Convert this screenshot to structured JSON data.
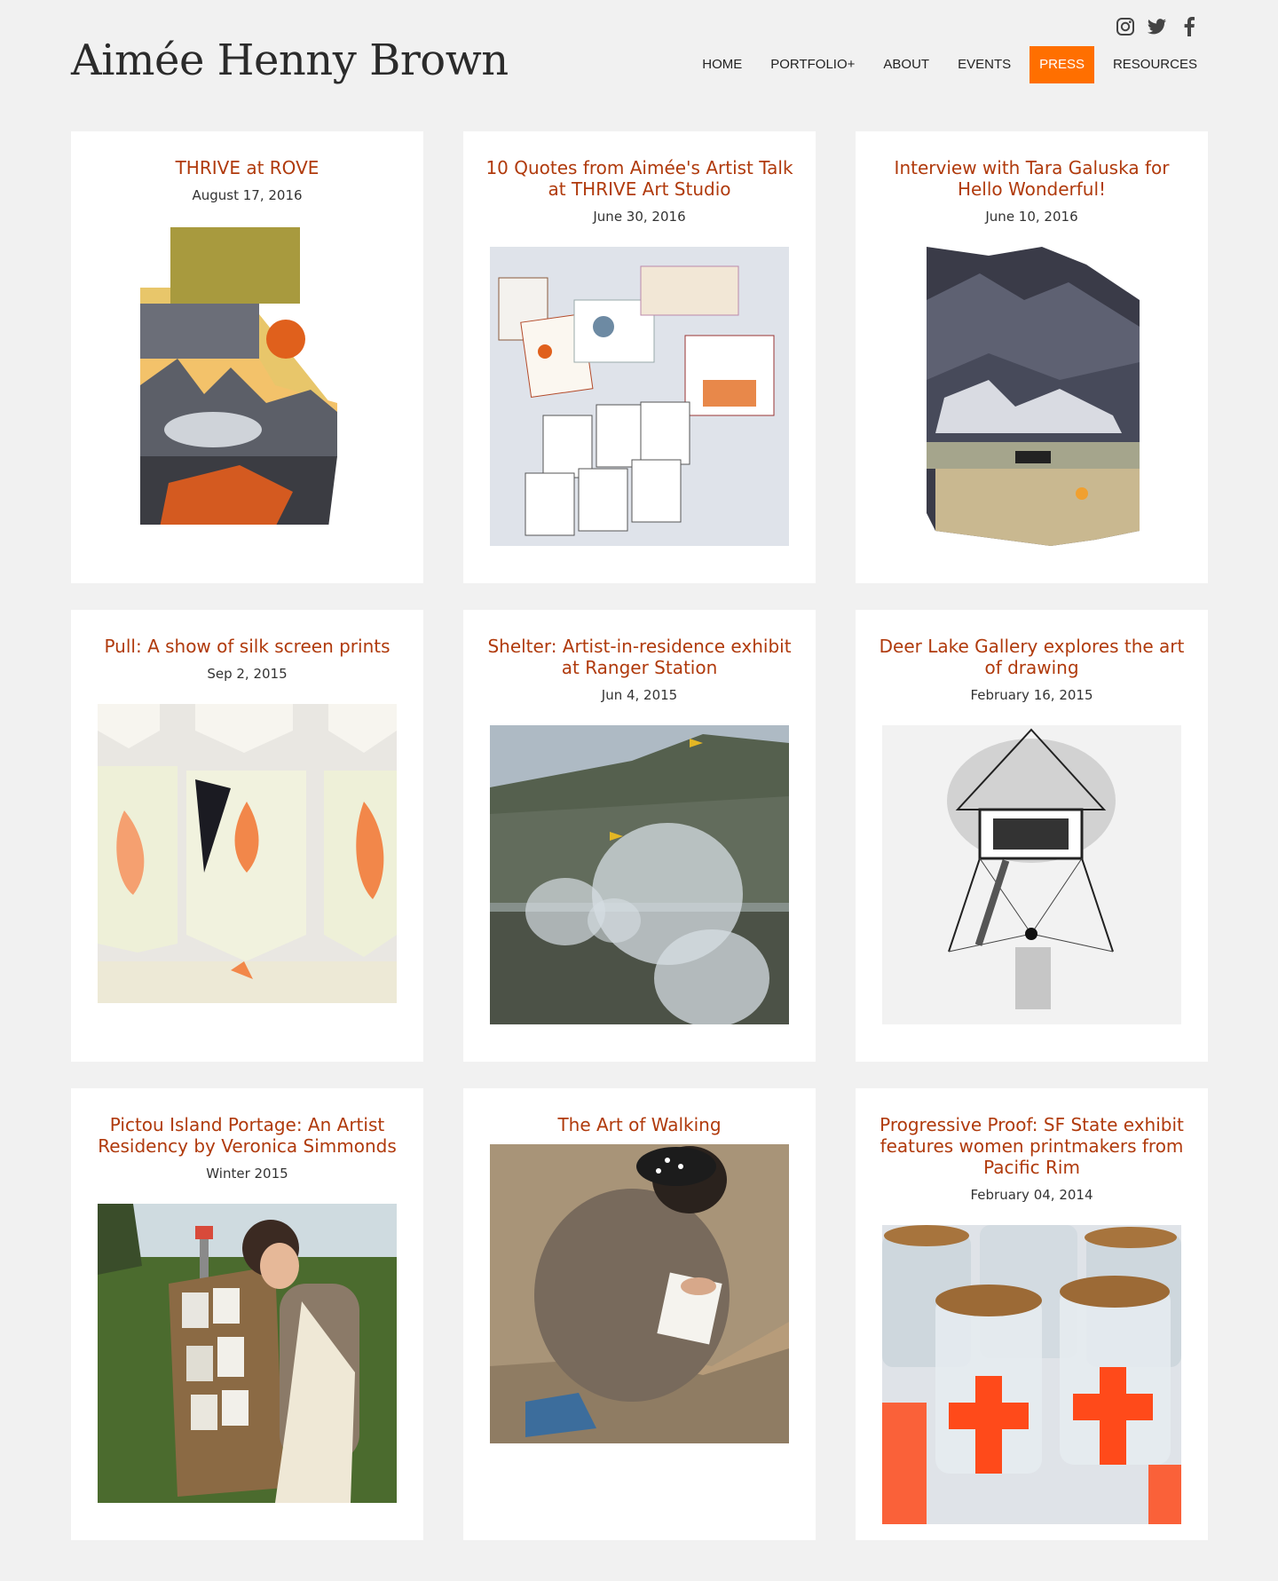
{
  "site": {
    "title": "Aimée Henny Brown"
  },
  "social": [
    {
      "icon": "instagram-icon"
    },
    {
      "icon": "twitter-icon"
    },
    {
      "icon": "facebook-icon"
    }
  ],
  "nav": {
    "items": [
      "HOME",
      "PORTFOLIO+",
      "ABOUT",
      "EVENTS",
      "PRESS",
      "RESOURCES"
    ],
    "active": "PRESS"
  },
  "colors": {
    "accent": "#ff6f00",
    "title_link": "#b03a0c",
    "background": "#f1f1f1",
    "card": "#ffffff"
  },
  "posts": [
    {
      "title": "THRIVE at ROVE",
      "date": "August 17, 2016",
      "image": "collage-mountains-domes"
    },
    {
      "title": "10 Quotes from Aimée's Artist Talk at THRIVE Art Studio",
      "date": "June 30, 2016",
      "image": "artist-books"
    },
    {
      "title": "Interview with Tara Galuska for Hello Wonderful!",
      "date": "June 10, 2016",
      "image": "collage-mountain-lake"
    },
    {
      "title": "Pull: A show of silk screen prints",
      "date": "Sep 2, 2015",
      "image": "silk-screen-banners"
    },
    {
      "title": "Shelter: Artist-in-residence exhibit at Ranger Station",
      "date": "Jun 4, 2015",
      "image": "geodesic-domes"
    },
    {
      "title": "Deer Lake Gallery explores the art of drawing",
      "date": "February 16, 2015",
      "image": "tower-drawing"
    },
    {
      "title": "Pictou Island Portage: An Artist Residency by Veronica Simmonds",
      "date": "Winter 2015",
      "image": "portable-library"
    },
    {
      "title": "The Art of Walking",
      "date": "",
      "image": "woman-drawing"
    },
    {
      "title": "Progressive Proof: SF State exhibit features women printmakers from Pacific Rim",
      "date": "February 04, 2014",
      "image": "jars-red-crosses"
    }
  ]
}
